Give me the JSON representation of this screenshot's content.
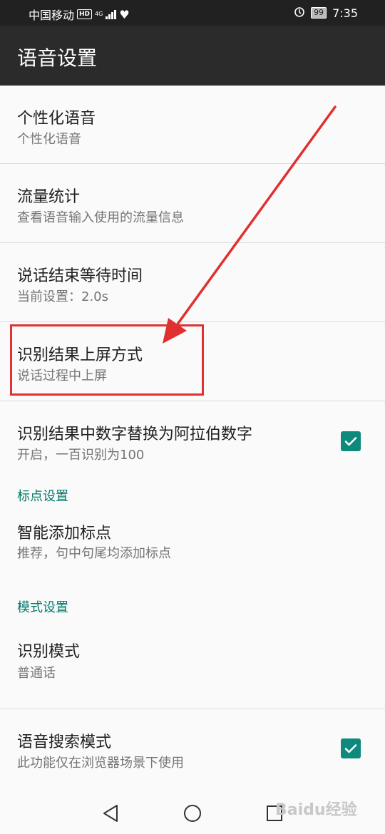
{
  "status": {
    "carrier": "中国移动",
    "hd": "HD",
    "network": "4G",
    "battery": "99",
    "time": "7:35"
  },
  "appbar": {
    "title": "语音设置"
  },
  "items": [
    {
      "title": "个性化语音",
      "subtitle": "个性化语音"
    },
    {
      "title": "流量统计",
      "subtitle": "查看语音输入使用的流量信息"
    },
    {
      "title": "说话结束等待时间",
      "subtitle": "当前设置：2.0s"
    },
    {
      "title": "识别结果上屏方式",
      "subtitle": "说话过程中上屏"
    },
    {
      "title": "识别结果中数字替换为阿拉伯数字",
      "subtitle": "开启，一百识别为100",
      "checked": true
    }
  ],
  "section_punct": {
    "label": "标点设置"
  },
  "punct_item": {
    "title": "智能添加标点",
    "subtitle": "推荐，句中句尾均添加标点"
  },
  "section_mode": {
    "label": "模式设置"
  },
  "mode_items": [
    {
      "title": "识别模式",
      "subtitle": "普通话"
    },
    {
      "title": "语音搜索模式",
      "subtitle": "此功能仅在浏览器场景下使用",
      "checked": true
    }
  ],
  "watermark": "Baidu经验",
  "colors": {
    "accent": "#00796b",
    "checkbox": "#0e8a7d",
    "annotation": "#e03030"
  }
}
